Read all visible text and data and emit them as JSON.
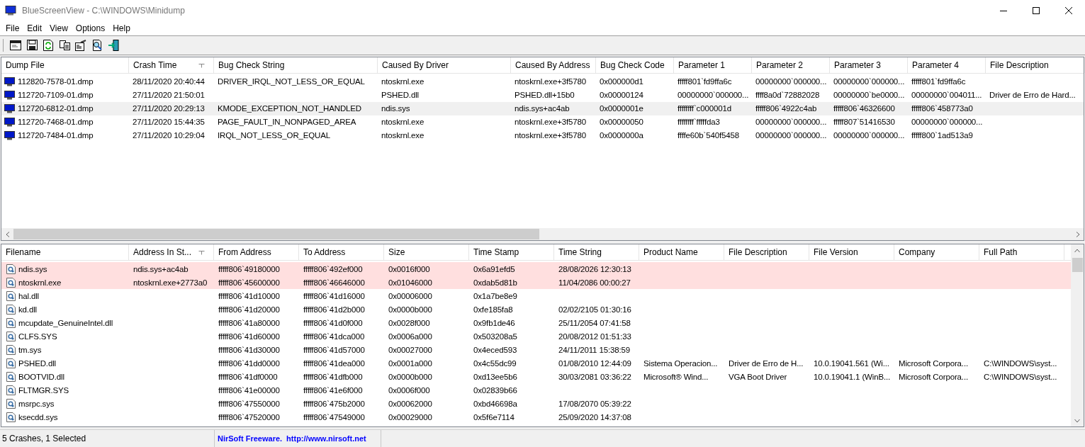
{
  "window": {
    "title": "BlueScreenView  -  C:\\WINDOWS\\Minidump"
  },
  "menu": [
    "File",
    "Edit",
    "View",
    "Options",
    "Help"
  ],
  "crashes": {
    "columns": [
      {
        "label": "Dump File",
        "sorted": false
      },
      {
        "label": "Crash Time",
        "sorted": true
      },
      {
        "label": "Bug Check String",
        "sorted": false
      },
      {
        "label": "Caused By Driver",
        "sorted": false
      },
      {
        "label": "Caused By Address",
        "sorted": false
      },
      {
        "label": "Bug Check Code",
        "sorted": false
      },
      {
        "label": "Parameter 1",
        "sorted": false
      },
      {
        "label": "Parameter 2",
        "sorted": false
      },
      {
        "label": "Parameter 3",
        "sorted": false
      },
      {
        "label": "Parameter 4",
        "sorted": false
      },
      {
        "label": "File Description",
        "sorted": false
      }
    ],
    "rows": [
      {
        "selected": false,
        "cells": [
          "112820-7578-01.dmp",
          "28/11/2020 20:40:44",
          "DRIVER_IRQL_NOT_LESS_OR_EQUAL",
          "ntoskrnl.exe",
          "ntoskrnl.exe+3f5780",
          "0x000000d1",
          "fffff801`fd9ffa6c",
          "00000000`000000...",
          "00000000`000000...",
          "fffff801`fd9ffa6c",
          ""
        ]
      },
      {
        "selected": false,
        "cells": [
          "112720-7109-01.dmp",
          "27/11/2020 21:50:01",
          "",
          "PSHED.dll",
          "PSHED.dll+15b0",
          "0x00000124",
          "00000000`000000...",
          "ffff8a0d`72882028",
          "00000000`be0000...",
          "00000000`004011...",
          "Driver de Erro de Hard..."
        ]
      },
      {
        "selected": true,
        "cells": [
          "112720-6812-01.dmp",
          "27/11/2020 20:29:13",
          "KMODE_EXCEPTION_NOT_HANDLED",
          "ndis.sys",
          "ndis.sys+ac4ab",
          "0x0000001e",
          "ffffffff`c000001d",
          "fffff806`4922c4ab",
          "fffff806`46326600",
          "fffff806`458773a0",
          ""
        ]
      },
      {
        "selected": false,
        "cells": [
          "112720-7468-01.dmp",
          "27/11/2020 15:44:35",
          "PAGE_FAULT_IN_NONPAGED_AREA",
          "ntoskrnl.exe",
          "ntoskrnl.exe+3f5780",
          "0x00000050",
          "ffffffff`fffffda3",
          "00000000`000000...",
          "fffff807`51416530",
          "00000000`000000...",
          ""
        ]
      },
      {
        "selected": false,
        "cells": [
          "112720-7484-01.dmp",
          "27/11/2020 10:29:04",
          "IRQL_NOT_LESS_OR_EQUAL",
          "ntoskrnl.exe",
          "ntoskrnl.exe+3f5780",
          "0x0000000a",
          "ffffe60b`540f5458",
          "00000000`000000...",
          "00000000`000000...",
          "fffff800`1ad513a9",
          ""
        ]
      }
    ]
  },
  "modules": {
    "columns": [
      {
        "label": "Filename",
        "sorted": false
      },
      {
        "label": "Address In St...",
        "sorted": true
      },
      {
        "label": "From Address",
        "sorted": false
      },
      {
        "label": "To Address",
        "sorted": false
      },
      {
        "label": "Size",
        "sorted": false
      },
      {
        "label": "Time Stamp",
        "sorted": false
      },
      {
        "label": "Time String",
        "sorted": false
      },
      {
        "label": "Product Name",
        "sorted": false
      },
      {
        "label": "File Description",
        "sorted": false
      },
      {
        "label": "File Version",
        "sorted": false
      },
      {
        "label": "Company",
        "sorted": false
      },
      {
        "label": "Full Path",
        "sorted": false
      }
    ],
    "rows": [
      {
        "highlighted": true,
        "cells": [
          "ndis.sys",
          "ndis.sys+ac4ab",
          "fffff806`49180000",
          "fffff806`492ef000",
          "0x0016f000",
          "0x6a91efd5",
          "28/08/2026 12:30:13",
          "",
          "",
          "",
          "",
          ""
        ]
      },
      {
        "highlighted": true,
        "cells": [
          "ntoskrnl.exe",
          "ntoskrnl.exe+2773a0",
          "fffff806`45600000",
          "fffff806`46646000",
          "0x01046000",
          "0xdab5d81b",
          "11/04/2086 00:00:27",
          "",
          "",
          "",
          "",
          ""
        ]
      },
      {
        "highlighted": false,
        "cells": [
          "hal.dll",
          "",
          "fffff806`41d10000",
          "fffff806`41d16000",
          "0x00006000",
          "0x1a7be8e9",
          "",
          "",
          "",
          "",
          "",
          ""
        ]
      },
      {
        "highlighted": false,
        "cells": [
          "kd.dll",
          "",
          "fffff806`41d20000",
          "fffff806`41d2b000",
          "0x0000b000",
          "0xfe185fa8",
          "02/02/2105 01:30:16",
          "",
          "",
          "",
          "",
          ""
        ]
      },
      {
        "highlighted": false,
        "cells": [
          "mcupdate_GenuineIntel.dll",
          "",
          "fffff806`41a80000",
          "fffff806`41d0f000",
          "0x0028f000",
          "0x9fb1de46",
          "25/11/2054 07:41:58",
          "",
          "",
          "",
          "",
          ""
        ]
      },
      {
        "highlighted": false,
        "cells": [
          "CLFS.SYS",
          "",
          "fffff806`41d60000",
          "fffff806`41dca000",
          "0x0006a000",
          "0x503208a5",
          "20/08/2012 01:51:33",
          "",
          "",
          "",
          "",
          ""
        ]
      },
      {
        "highlighted": false,
        "cells": [
          "tm.sys",
          "",
          "fffff806`41d30000",
          "fffff806`41d57000",
          "0x00027000",
          "0x4eced593",
          "24/11/2011 15:38:59",
          "",
          "",
          "",
          "",
          ""
        ]
      },
      {
        "highlighted": false,
        "cells": [
          "PSHED.dll",
          "",
          "fffff806`41dd0000",
          "fffff806`41dea000",
          "0x0001a000",
          "0x4c55dc99",
          "01/08/2010 12:44:09",
          "Sistema Operacion...",
          "Driver de Erro de H...",
          "10.0.19041.561 (Wi...",
          "Microsoft Corpora...",
          "C:\\WINDOWS\\syst..."
        ]
      },
      {
        "highlighted": false,
        "cells": [
          "BOOTVID.dll",
          "",
          "fffff806`41df0000",
          "fffff806`41dfb000",
          "0x0000b000",
          "0xd13ee5b6",
          "30/03/2081 03:36:22",
          "Microsoft® Wind...",
          "VGA Boot Driver",
          "10.0.19041.1 (WinB...",
          "Microsoft Corpora...",
          "C:\\WINDOWS\\syst..."
        ]
      },
      {
        "highlighted": false,
        "cells": [
          "FLTMGR.SYS",
          "",
          "fffff806`41e00000",
          "fffff806`41e6f000",
          "0x0006f000",
          "0x02839b66",
          "",
          "",
          "",
          "",
          "",
          ""
        ]
      },
      {
        "highlighted": false,
        "cells": [
          "msrpc.sys",
          "",
          "fffff806`47550000",
          "fffff806`475b2000",
          "0x00062000",
          "0xbd46698a",
          "17/08/2070 05:39:22",
          "",
          "",
          "",
          "",
          ""
        ]
      },
      {
        "highlighted": false,
        "cells": [
          "ksecdd.sys",
          "",
          "fffff806`47520000",
          "fffff806`47549000",
          "0x00029000",
          "0x5f6e7114",
          "25/09/2020 14:37:08",
          "",
          "",
          "",
          "",
          ""
        ]
      }
    ]
  },
  "status_bar": {
    "summary": "5 Crashes, 1 Selected",
    "credit": "NirSoft Freeware.",
    "link": "http://www.nirsoft.net"
  }
}
